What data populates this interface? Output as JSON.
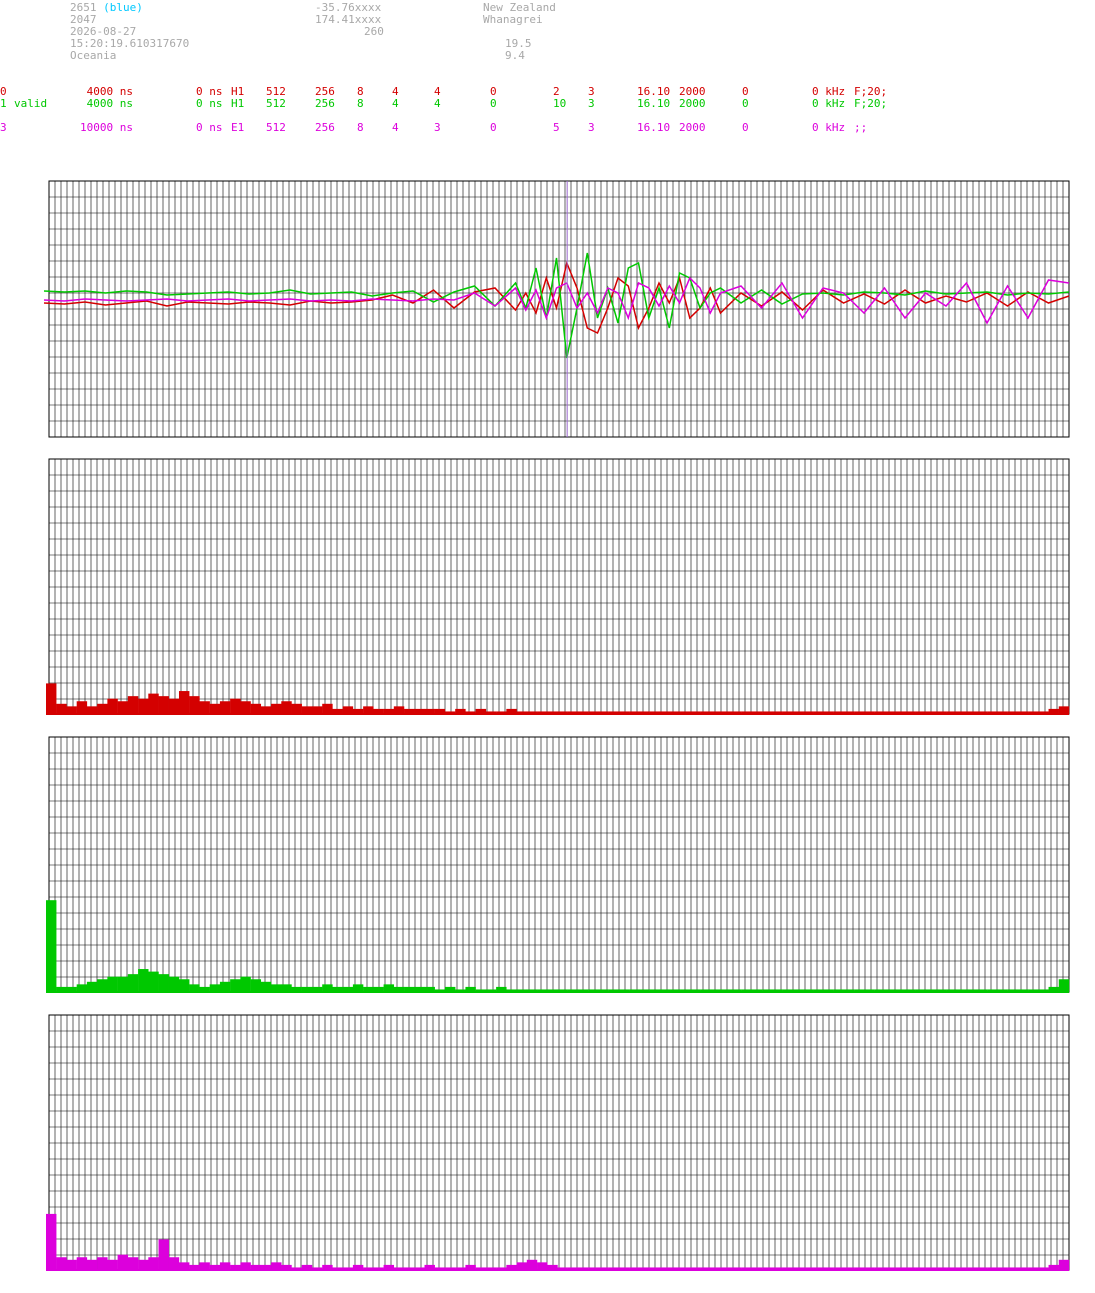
{
  "header": {
    "station_id": "2651",
    "station_color_note": "(blue)",
    "line2": "2047",
    "date": "2026-08-27",
    "time": "15:20:19.610317670",
    "region": "Oceania",
    "latitude": "-35.76xxxx",
    "longitude": "174.41xxxx",
    "altitude": "260",
    "country": "New Zealand",
    "city": "Whanagrei",
    "value_a": "19.5",
    "value_b": "9.4"
  },
  "channels": [
    {
      "id": "0",
      "flag": "",
      "sample": "4000 ns",
      "offset": "0 ns",
      "type": "H1",
      "c1": "512",
      "c2": "256",
      "c3": "8",
      "c4": "4",
      "c5": "4",
      "c6": "0",
      "c7": "2",
      "c8": "3",
      "c9": "16.10",
      "c10": "2000",
      "c11": "0",
      "freq": "0 kHz",
      "filter": "F;20;",
      "color": "#d40000"
    },
    {
      "id": "1",
      "flag": "valid",
      "sample": "4000 ns",
      "offset": "0 ns",
      "type": "H1",
      "c1": "512",
      "c2": "256",
      "c3": "8",
      "c4": "4",
      "c5": "4",
      "c6": "0",
      "c7": "10",
      "c8": "3",
      "c9": "16.10",
      "c10": "2000",
      "c11": "0",
      "freq": "0 kHz",
      "filter": "F;20;",
      "color": "#00c800"
    },
    {
      "id": "3",
      "flag": "",
      "sample": "10000 ns",
      "offset": "0 ns",
      "type": "E1",
      "c1": "512",
      "c2": "256",
      "c3": "8",
      "c4": "4",
      "c5": "3",
      "c6": "0",
      "c7": "5",
      "c8": "3",
      "c9": "16.10",
      "c10": "2000",
      "c11": "0",
      "freq": "0 kHz",
      "filter": ";;",
      "color": "#dc00dc"
    }
  ],
  "chart_data": [
    {
      "type": "line",
      "ylim": [
        -1,
        1
      ],
      "grid": true,
      "marker_x": 0.508,
      "x": [
        0,
        0.02,
        0.04,
        0.06,
        0.08,
        0.1,
        0.12,
        0.14,
        0.16,
        0.18,
        0.2,
        0.22,
        0.24,
        0.26,
        0.28,
        0.3,
        0.32,
        0.34,
        0.36,
        0.38,
        0.4,
        0.42,
        0.44,
        0.46,
        0.47,
        0.48,
        0.49,
        0.5,
        0.51,
        0.52,
        0.53,
        0.54,
        0.55,
        0.56,
        0.57,
        0.58,
        0.59,
        0.6,
        0.61,
        0.62,
        0.63,
        0.64,
        0.65,
        0.66,
        0.68,
        0.7,
        0.72,
        0.74,
        0.76,
        0.78,
        0.8,
        0.82,
        0.84,
        0.86,
        0.88,
        0.9,
        0.92,
        0.94,
        0.96,
        0.98,
        1.0
      ],
      "series": [
        {
          "color": "#d40000",
          "values": [
            -0.05,
            -0.06,
            -0.04,
            -0.07,
            -0.05,
            -0.03,
            -0.08,
            -0.04,
            -0.05,
            -0.06,
            -0.04,
            -0.05,
            -0.07,
            -0.03,
            -0.05,
            -0.04,
            -0.02,
            0.03,
            -0.05,
            0.08,
            -0.1,
            0.06,
            0.1,
            -0.12,
            0.05,
            -0.15,
            0.2,
            -0.1,
            0.35,
            0.1,
            -0.3,
            -0.35,
            -0.1,
            0.2,
            0.12,
            -0.3,
            -0.1,
            0.15,
            -0.05,
            0.2,
            -0.2,
            -0.1,
            0.1,
            -0.15,
            0.05,
            -0.08,
            0.06,
            -0.12,
            0.08,
            -0.05,
            0.04,
            -0.06,
            0.08,
            -0.05,
            0.02,
            -0.04,
            0.05,
            -0.08,
            0.06,
            -0.05,
            0.02
          ]
        },
        {
          "color": "#00c800",
          "values": [
            0.07,
            0.06,
            0.07,
            0.05,
            0.07,
            0.06,
            0.03,
            0.04,
            0.05,
            0.06,
            0.04,
            0.05,
            0.08,
            0.04,
            0.05,
            0.06,
            0.02,
            0.05,
            0.07,
            -0.04,
            0.06,
            0.12,
            -0.08,
            0.15,
            -0.1,
            0.3,
            -0.2,
            0.4,
            -0.6,
            -0.1,
            0.45,
            -0.2,
            0.1,
            -0.25,
            0.3,
            0.35,
            -0.2,
            0.1,
            -0.3,
            0.25,
            0.2,
            -0.1,
            0.05,
            0.1,
            -0.05,
            0.08,
            -0.06,
            0.04,
            0.05,
            0.03,
            0.06,
            0.05,
            0.03,
            0.07,
            0.04,
            0.05,
            0.06,
            0.03,
            0.05,
            0.04,
            0.06
          ]
        },
        {
          "color": "#dc00dc",
          "values": [
            -0.02,
            -0.03,
            -0.01,
            -0.02,
            -0.03,
            -0.02,
            -0.01,
            -0.03,
            -0.02,
            -0.01,
            -0.03,
            -0.02,
            -0.01,
            -0.03,
            -0.02,
            -0.03,
            -0.01,
            -0.02,
            -0.03,
            -0.01,
            -0.02,
            0.05,
            -0.08,
            0.1,
            -0.12,
            0.08,
            -0.2,
            0.1,
            0.15,
            -0.1,
            0.05,
            -0.15,
            0.1,
            0.05,
            -0.2,
            0.15,
            0.1,
            -0.08,
            0.12,
            -0.05,
            0.2,
            0.1,
            -0.15,
            0.05,
            0.12,
            -0.1,
            0.15,
            -0.2,
            0.1,
            0.05,
            -0.15,
            0.1,
            -0.2,
            0.05,
            -0.08,
            0.15,
            -0.25,
            0.12,
            -0.2,
            0.18,
            0.15
          ]
        }
      ]
    },
    {
      "type": "bar",
      "color": "#d40000",
      "ylim": [
        0,
        1
      ],
      "values": [
        0.12,
        0.04,
        0.03,
        0.05,
        0.03,
        0.04,
        0.06,
        0.05,
        0.07,
        0.06,
        0.08,
        0.07,
        0.06,
        0.09,
        0.07,
        0.05,
        0.04,
        0.05,
        0.06,
        0.05,
        0.04,
        0.03,
        0.04,
        0.05,
        0.04,
        0.03,
        0.03,
        0.04,
        0.02,
        0.03,
        0.02,
        0.03,
        0.02,
        0.02,
        0.03,
        0.02,
        0.02,
        0.02,
        0.02,
        0.01,
        0.02,
        0.01,
        0.02,
        0.01,
        0.01,
        0.02,
        0.01,
        0.01,
        0.01,
        0.01,
        0.01,
        0.01,
        0.01,
        0.01,
        0.01,
        0.01,
        0.01,
        0.01,
        0.01,
        0.01,
        0.01,
        0.01,
        0.01,
        0.01,
        0.01,
        0.01,
        0.01,
        0.01,
        0.01,
        0.01,
        0.01,
        0.01,
        0.01,
        0.01,
        0.01,
        0.01,
        0.01,
        0.01,
        0.01,
        0.01,
        0.01,
        0.01,
        0.01,
        0.01,
        0.01,
        0.01,
        0.01,
        0.01,
        0.01,
        0.01,
        0.01,
        0.01,
        0.01,
        0.01,
        0.01,
        0.01,
        0.01,
        0.01,
        0.02,
        0.03
      ]
    },
    {
      "type": "bar",
      "color": "#00c800",
      "ylim": [
        0,
        1
      ],
      "values": [
        0.36,
        0.02,
        0.02,
        0.03,
        0.04,
        0.05,
        0.06,
        0.06,
        0.07,
        0.09,
        0.08,
        0.07,
        0.06,
        0.05,
        0.03,
        0.02,
        0.03,
        0.04,
        0.05,
        0.06,
        0.05,
        0.04,
        0.03,
        0.03,
        0.02,
        0.02,
        0.02,
        0.03,
        0.02,
        0.02,
        0.03,
        0.02,
        0.02,
        0.03,
        0.02,
        0.02,
        0.02,
        0.02,
        0.01,
        0.02,
        0.01,
        0.02,
        0.01,
        0.01,
        0.02,
        0.01,
        0.01,
        0.01,
        0.01,
        0.01,
        0.01,
        0.01,
        0.01,
        0.01,
        0.01,
        0.01,
        0.01,
        0.01,
        0.01,
        0.01,
        0.01,
        0.01,
        0.01,
        0.01,
        0.01,
        0.01,
        0.01,
        0.01,
        0.01,
        0.01,
        0.01,
        0.01,
        0.01,
        0.01,
        0.01,
        0.01,
        0.01,
        0.01,
        0.01,
        0.01,
        0.01,
        0.01,
        0.01,
        0.01,
        0.01,
        0.01,
        0.01,
        0.01,
        0.01,
        0.01,
        0.01,
        0.01,
        0.01,
        0.01,
        0.01,
        0.01,
        0.01,
        0.01,
        0.02,
        0.05
      ]
    },
    {
      "type": "bar",
      "color": "#dc00dc",
      "ylim": [
        0,
        1
      ],
      "values": [
        0.22,
        0.05,
        0.04,
        0.05,
        0.04,
        0.05,
        0.04,
        0.06,
        0.05,
        0.04,
        0.05,
        0.12,
        0.05,
        0.03,
        0.02,
        0.03,
        0.02,
        0.03,
        0.02,
        0.03,
        0.02,
        0.02,
        0.03,
        0.02,
        0.01,
        0.02,
        0.01,
        0.02,
        0.01,
        0.01,
        0.02,
        0.01,
        0.01,
        0.02,
        0.01,
        0.01,
        0.01,
        0.02,
        0.01,
        0.01,
        0.01,
        0.02,
        0.01,
        0.01,
        0.01,
        0.02,
        0.03,
        0.04,
        0.03,
        0.02,
        0.01,
        0.01,
        0.01,
        0.01,
        0.01,
        0.01,
        0.01,
        0.01,
        0.01,
        0.01,
        0.01,
        0.01,
        0.01,
        0.01,
        0.01,
        0.01,
        0.01,
        0.01,
        0.01,
        0.01,
        0.01,
        0.01,
        0.01,
        0.01,
        0.01,
        0.01,
        0.01,
        0.01,
        0.01,
        0.01,
        0.01,
        0.01,
        0.01,
        0.01,
        0.01,
        0.01,
        0.01,
        0.01,
        0.01,
        0.01,
        0.01,
        0.01,
        0.01,
        0.01,
        0.01,
        0.01,
        0.01,
        0.01,
        0.02,
        0.04
      ]
    }
  ]
}
